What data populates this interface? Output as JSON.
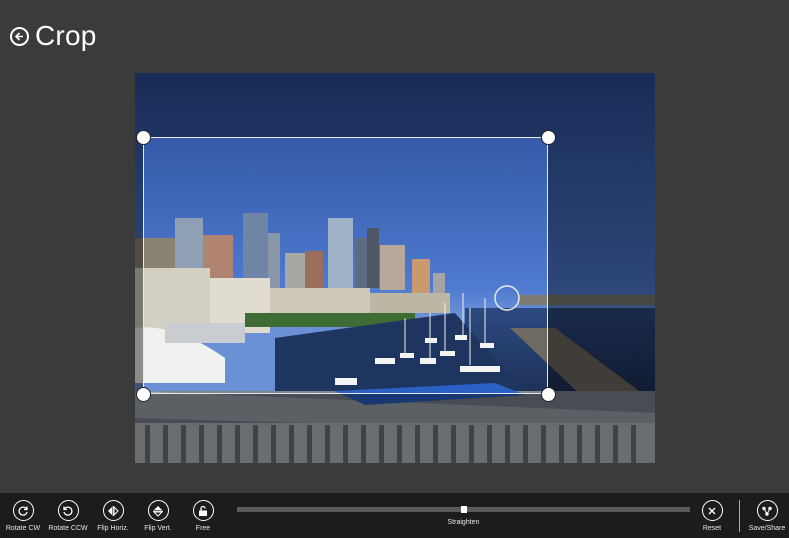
{
  "header": {
    "title": "Crop",
    "back_icon": "back-arrow-icon"
  },
  "photo": {
    "description_icon": "photo-image"
  },
  "toolbar": {
    "rotate_cw_label": "Rotate CW",
    "rotate_ccw_label": "Rotate CCW",
    "flip_horiz_label": "Flip Horiz.",
    "flip_vert_label": "Flip Vert.",
    "free_label": "Free",
    "straighten_label": "Straighten",
    "straighten_value": 0.5,
    "reset_label": "Reset",
    "save_share_label": "Save/Share"
  },
  "colors": {
    "background": "#3b3b3b",
    "appbar": "#1c1c1c",
    "accent": "#ffffff"
  }
}
